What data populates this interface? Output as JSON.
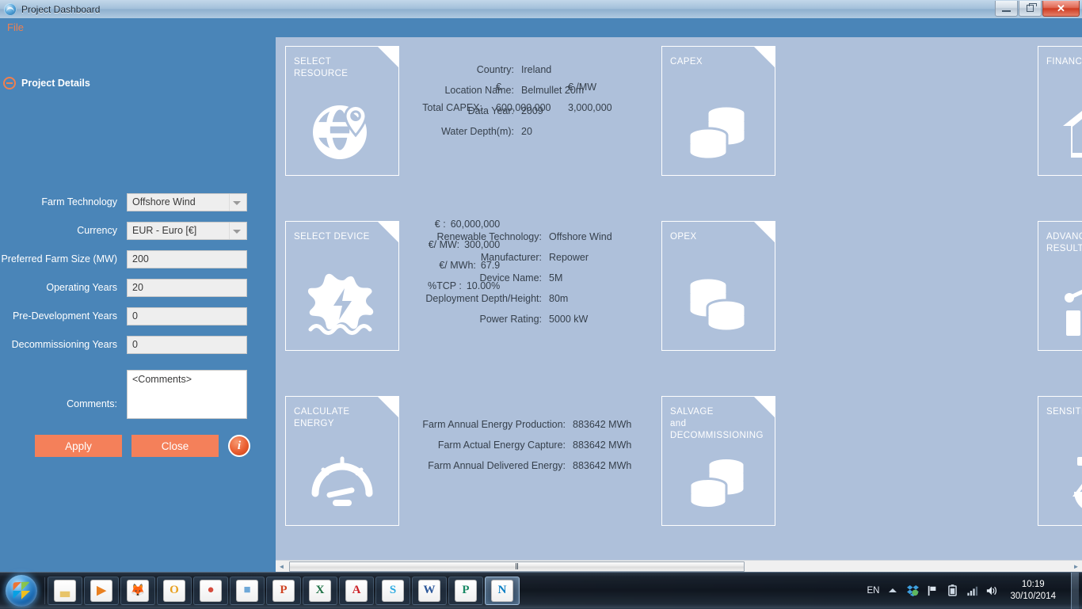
{
  "window": {
    "title": "Project Dashboard",
    "icon": "app-globe-icon",
    "minimize_label": "Minimize",
    "restore_label": "Restore",
    "close_label": "Close"
  },
  "menubar": {
    "items": [
      {
        "label": "File"
      }
    ]
  },
  "group_header": {
    "label": "Project Details",
    "toggle": "collapse-icon"
  },
  "sidebar": {
    "fields": [
      {
        "label": "Farm Technology",
        "type": "combo",
        "value": "Offshore Wind"
      },
      {
        "label": "Currency",
        "type": "combo",
        "value": "EUR - Euro [€]"
      },
      {
        "label": "Preferred Farm Size (MW)",
        "type": "text",
        "value": "200"
      },
      {
        "label": "Operating Years",
        "type": "text",
        "value": "20"
      },
      {
        "label": "Pre-Development Years",
        "type": "text",
        "value": "0"
      },
      {
        "label": "Decommissioning Years",
        "type": "text",
        "value": "0"
      }
    ],
    "comments": {
      "label": "Comments:",
      "value": "<Comments>"
    },
    "buttons": {
      "apply": "Apply",
      "close": "Close",
      "info": "i"
    }
  },
  "cards": {
    "select_resource": {
      "title": "SELECT RESOURCE",
      "icon": "globe-pin-icon",
      "rows": [
        {
          "key": "Country:",
          "value": "Ireland"
        },
        {
          "key": "Location Name:",
          "value": "Belmullet 20m"
        },
        {
          "key": "Data Year:",
          "value": "2009"
        },
        {
          "key": "Water Depth(m):",
          "value": "20"
        }
      ]
    },
    "capex": {
      "title": "CAPEX",
      "icon": "coins-icon",
      "col1": "€",
      "col2": "€ /MW",
      "row_label": "Total CAPEX:",
      "row_v1": "600,000,000",
      "row_v2": "3,000,000"
    },
    "financial": {
      "title": "FINANCIAL",
      "icon": "house-gear-icon"
    },
    "select_device": {
      "title": "SELECT DEVICE",
      "icon": "turbine-wave-icon",
      "rows": [
        {
          "key": "Renewable Technology:",
          "value": "Offshore Wind"
        },
        {
          "key": "Manufacturer:",
          "value": "Repower"
        },
        {
          "key": "Device Name:",
          "value": "5M"
        },
        {
          "key": "Deployment Depth/Height:",
          "value": "80m"
        },
        {
          "key": "Power Rating:",
          "value": "5000 kW"
        }
      ]
    },
    "opex": {
      "title": "OPEX",
      "icon": "coins-icon",
      "rows": [
        {
          "key": "€ :",
          "value": "60,000,000"
        },
        {
          "key": "€/ MW:",
          "value": "300,000"
        },
        {
          "key": "€/ MWh:",
          "value": "67.9"
        },
        {
          "key": "%TCP :",
          "value": "10.00%"
        }
      ]
    },
    "advanced_results": {
      "title_line1": "ADVANCED",
      "title_line2": "RESULTS",
      "icon": "bar-chart-icon"
    },
    "calculate_energy": {
      "title": "CALCULATE ENERGY",
      "icon": "gauge-icon",
      "rows": [
        {
          "key": "Farm Annual Energy Production:",
          "value": "883642 MWh"
        },
        {
          "key": "Farm Actual Energy Capture:",
          "value": "883642 MWh"
        },
        {
          "key": "Farm Annual Delivered Energy:",
          "value": "883642 MWh"
        }
      ]
    },
    "salvage": {
      "title_line1": "SALVAGE",
      "title_line2": "and",
      "title_line3": "DECOMMISSIONING",
      "icon": "coins-icon"
    },
    "sensitivity": {
      "title": "SENSITIVITY",
      "icon": "scales-icon"
    }
  },
  "scrollbar": {
    "left_arrow": "◄",
    "right_arrow": "►"
  },
  "taskbar": {
    "start": "start-orb-icon",
    "apps": [
      {
        "name": "file-explorer",
        "glyph": "▃",
        "color": "#e8c46a",
        "active": false
      },
      {
        "name": "media-player",
        "glyph": "▶",
        "color": "#e98020",
        "active": false
      },
      {
        "name": "firefox",
        "glyph": "🦊",
        "color": "#e06424",
        "active": false
      },
      {
        "name": "outlook",
        "glyph": "O",
        "color": "#e8a020",
        "active": false
      },
      {
        "name": "chrome",
        "glyph": "●",
        "color": "#d64b3d",
        "active": false
      },
      {
        "name": "photo-viewer",
        "glyph": "■",
        "color": "#6ea8d8",
        "active": false
      },
      {
        "name": "powerpoint",
        "glyph": "P",
        "color": "#d04423",
        "active": false
      },
      {
        "name": "excel",
        "glyph": "X",
        "color": "#1e7145",
        "active": false
      },
      {
        "name": "adobe-reader",
        "glyph": "A",
        "color": "#cc2127",
        "active": false
      },
      {
        "name": "skype",
        "glyph": "S",
        "color": "#2aa9e0",
        "active": false
      },
      {
        "name": "word",
        "glyph": "W",
        "color": "#2b579a",
        "active": false
      },
      {
        "name": "publisher",
        "glyph": "P",
        "color": "#188864",
        "active": false
      },
      {
        "name": "navitas",
        "glyph": "N",
        "color": "#0b7fc4",
        "active": true
      }
    ],
    "tray": {
      "language": "EN",
      "icons": [
        "chevron-up-icon",
        "dropbox-icon",
        "flag-icon",
        "battery-icon",
        "network-icon",
        "volume-icon"
      ],
      "time": "10:19",
      "date": "30/10/2014"
    }
  },
  "colors": {
    "sidebar_blue": "#4a85b8",
    "content_blue": "#aec0da",
    "accent_orange": "#f4805a",
    "menu_orange": "#f07f4e"
  }
}
